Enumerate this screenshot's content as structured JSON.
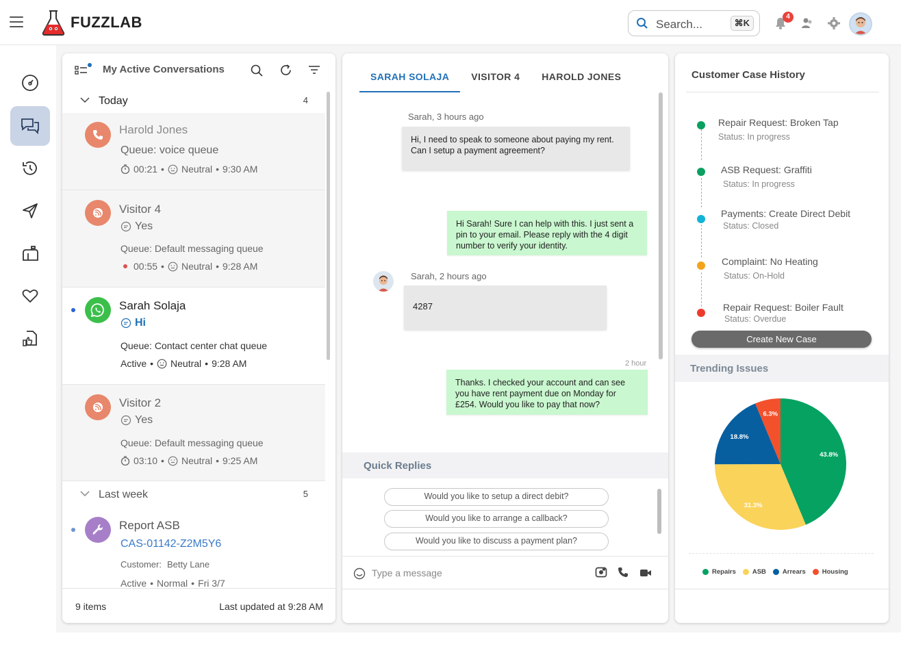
{
  "app": {
    "brand": "FUZZLAB"
  },
  "search": {
    "placeholder": "Search...",
    "shortcut": "⌘K"
  },
  "notifications": {
    "count": "4"
  },
  "conversations": {
    "title": "My Active Conversations",
    "groups": [
      {
        "title": "Today",
        "count": "4"
      },
      {
        "title": "Last week",
        "count": "5"
      }
    ],
    "items": [
      {
        "name": "Harold Jones",
        "queue": "Queue: voice queue",
        "time": "00:21",
        "sentiment": "Neutral",
        "clock": "9:30 AM",
        "icon": "phone-icon",
        "color": "#e8876b"
      },
      {
        "name": "Visitor 4",
        "preview": "Yes",
        "queue": "Queue: Default messaging queue",
        "time": "00:55",
        "sentiment": "Neutral",
        "clock": "9:28 AM",
        "icon": "chat-icon",
        "color": "#e8876b"
      },
      {
        "name": "Sarah Solaja",
        "preview": "Hi",
        "queue": "Queue: Contact center chat queue",
        "state": "Active",
        "sentiment": "Neutral",
        "clock": "9:28 AM",
        "icon": "whatsapp-icon",
        "color": "#3bbf4a"
      },
      {
        "name": "Visitor 2",
        "preview": "Yes",
        "queue": "Queue: Default messaging queue",
        "time": "03:10",
        "sentiment": "Neutral",
        "clock": "9:25 AM",
        "icon": "chat-icon",
        "color": "#e8876b"
      },
      {
        "name": "Report ASB",
        "case": "CAS-01142-Z2M5Y6",
        "customer_label": "Customer:",
        "customer": "Betty Lane",
        "state": "Active",
        "priority": "Normal",
        "date": "Fri 3/7",
        "icon": "wrench-icon",
        "color": "#a77fc8"
      }
    ],
    "footer": {
      "items": "9 items",
      "updated": "Last updated at 9:28 AM"
    }
  },
  "chat": {
    "tabs": [
      "SARAH SOLAJA",
      "VISITOR 4",
      "HAROLD JONES"
    ],
    "messages": [
      {
        "meta": "Sarah, 3 hours ago",
        "text": "Hi, I need to speak to someone about paying my rent. Can I setup a payment agreement?"
      },
      {
        "text": "Hi Sarah! Sure I can help with this. I just sent a pin to your email. Please reply with the 4 digit number to verify your identity."
      },
      {
        "meta": "Sarah, 2 hours ago",
        "text": "4287"
      },
      {
        "meta": "2 hour",
        "text": "Thanks. I checked your account and can see you have rent payment due on Monday for £254. Would you like to pay that now?"
      }
    ],
    "quick_replies_title": "Quick Replies",
    "quick_replies": [
      "Would you like to setup a direct debit?",
      "Would you like to arrange a callback?",
      "Would you like to discuss a payment plan?"
    ],
    "compose_placeholder": "Type a message"
  },
  "case_history": {
    "title": "Customer Case History",
    "items": [
      {
        "title": "Repair Request: Broken Tap",
        "status": "Status: In progress",
        "color": "#0aa060"
      },
      {
        "title": "ASB Request: Graffiti",
        "status": "Status: In progress",
        "color": "#0aa060"
      },
      {
        "title": "Payments: Create Direct Debit",
        "status": "Status: Closed",
        "color": "#12b3d6"
      },
      {
        "title": "Complaint: No Heating",
        "status": "Status: On-Hold",
        "color": "#f3a31a"
      },
      {
        "title": "Repair Request: Boiler Fault",
        "status": "Status: Overdue",
        "color": "#ef3b2c"
      }
    ],
    "new_case": "Create New Case"
  },
  "trending": {
    "title": "Trending Issues"
  },
  "chart_data": {
    "type": "pie",
    "categories": [
      "Repairs",
      "ASB",
      "Arrears",
      "Housing"
    ],
    "values": [
      43.8,
      31.3,
      18.8,
      6.3
    ],
    "labels": [
      "43.8%",
      "31.3%",
      "18.8%",
      "6.3%"
    ],
    "colors": [
      "#05a262",
      "#fad35a",
      "#075fa0",
      "#f3502c"
    ],
    "legend": "bottom"
  }
}
